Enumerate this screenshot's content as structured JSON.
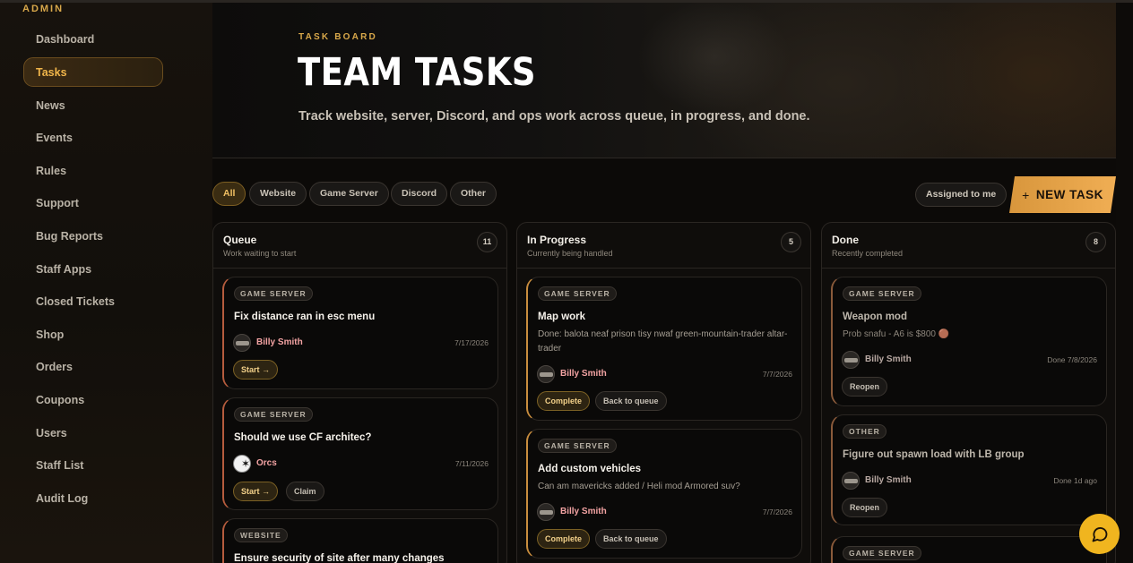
{
  "sidebar": {
    "section": "ADMIN",
    "items": [
      {
        "label": "Dashboard"
      },
      {
        "label": "Tasks"
      },
      {
        "label": "News"
      },
      {
        "label": "Events"
      },
      {
        "label": "Rules"
      },
      {
        "label": "Support"
      },
      {
        "label": "Bug Reports"
      },
      {
        "label": "Staff Apps"
      },
      {
        "label": "Closed Tickets"
      },
      {
        "label": "Shop"
      },
      {
        "label": "Orders"
      },
      {
        "label": "Coupons"
      },
      {
        "label": "Users"
      },
      {
        "label": "Staff List"
      },
      {
        "label": "Audit Log"
      }
    ],
    "active_index": 1
  },
  "hero": {
    "eyebrow": "TASK BOARD",
    "title": "TEAM TASKS",
    "subtitle": "Track website, server, Discord, and ops work across queue, in progress, and done."
  },
  "filters": [
    "All",
    "Website",
    "Game Server",
    "Discord",
    "Other"
  ],
  "active_filter": "All",
  "toolbar": {
    "assigned_label": "Assigned to me",
    "new_task_icon": "+",
    "new_task_label": "NEW TASK"
  },
  "columns": [
    {
      "title": "Queue",
      "subtitle": "Work waiting to start",
      "count": "11",
      "cards": [
        {
          "tag": "GAME SERVER",
          "title": "Fix distance ran in esc menu",
          "user": "Billy Smith",
          "date": "7/17/2026",
          "actions": [
            "Start →"
          ]
        },
        {
          "tag": "GAME SERVER",
          "title": "Should we use CF architec?",
          "user": "Orcs",
          "date": "7/11/2026",
          "actions": [
            "Start →",
            "Claim"
          ]
        },
        {
          "tag": "WEBSITE",
          "title": "Ensure security of site after many changes"
        }
      ]
    },
    {
      "title": "In Progress",
      "subtitle": "Currently being handled",
      "count": "5",
      "cards": [
        {
          "tag": "GAME SERVER",
          "title": "Map work",
          "desc": "Done: balota neaf prison tisy nwaf green-mountain-trader altar-trader",
          "user": "Billy Smith",
          "date": "7/7/2026",
          "actions": [
            "Complete",
            "Back to queue"
          ]
        },
        {
          "tag": "GAME SERVER",
          "title": "Add custom vehicles",
          "desc": "Can am mavericks added / Heli mod Armored suv?",
          "user": "Billy Smith",
          "date": "7/7/2026",
          "actions": [
            "Complete",
            "Back to queue"
          ]
        }
      ]
    },
    {
      "title": "Done",
      "subtitle": "Recently completed",
      "count": "8",
      "cards": [
        {
          "tag": "GAME SERVER",
          "title": "Weapon mod",
          "desc": "Prob snafu - A6 is $800 🟤",
          "user": "Billy Smith",
          "date": "Done 7/8/2026",
          "actions": [
            "Reopen"
          ]
        },
        {
          "tag": "OTHER",
          "title": "Figure out spawn load with LB group",
          "user": "Billy Smith",
          "date": "Done 1d ago",
          "actions": [
            "Reopen"
          ]
        },
        {
          "tag": "GAME SERVER"
        }
      ]
    }
  ],
  "colors": {
    "accent": "#f0ae54",
    "brand_gold": "#d9a84a",
    "chat": "#f0b51f"
  }
}
